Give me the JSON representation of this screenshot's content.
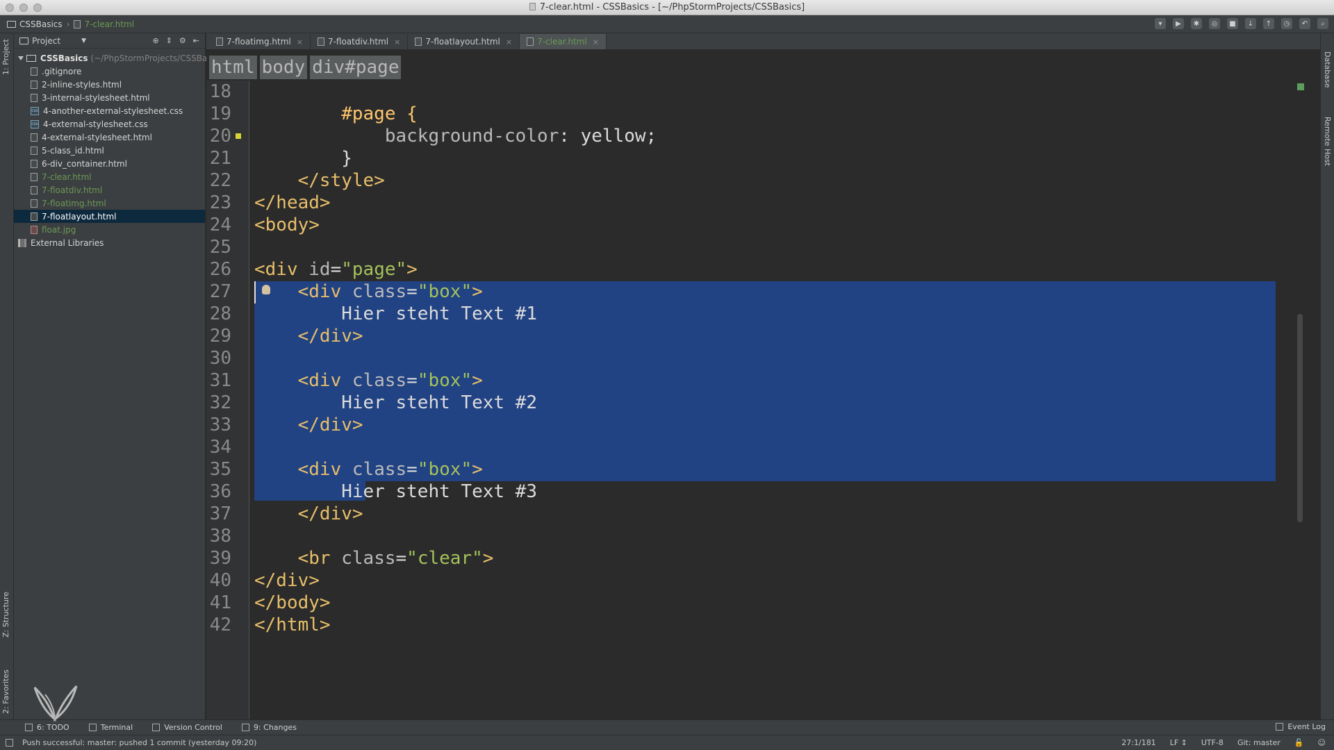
{
  "window": {
    "title": "7-clear.html - CSSBasics - [~/PhpStormProjects/CSSBasics]"
  },
  "navbar": {
    "project": "CSSBasics",
    "file": "7-clear.html"
  },
  "left_strip": {
    "project_tab": "1: Project",
    "structure_tab": "Z: Structure",
    "favorites_tab": "2: Favorites"
  },
  "right_strip": {
    "database_tab": "Database",
    "remote_host_tab": "Remote Host"
  },
  "project_panel": {
    "header": "Project",
    "root": {
      "name": "CSSBasics",
      "path": "(~/PhpStormProjects/CSSBasics)"
    },
    "items": [
      {
        "label": ".gitignore",
        "kind": "file",
        "vcs": "none"
      },
      {
        "label": "2-inline-styles.html",
        "kind": "html",
        "vcs": "none"
      },
      {
        "label": "3-internal-stylesheet.html",
        "kind": "html",
        "vcs": "none"
      },
      {
        "label": "4-another-external-stylesheet.css",
        "kind": "css",
        "vcs": "none"
      },
      {
        "label": "4-external-stylesheet.css",
        "kind": "css",
        "vcs": "none"
      },
      {
        "label": "4-external-stylesheet.html",
        "kind": "html",
        "vcs": "none"
      },
      {
        "label": "5-class_id.html",
        "kind": "html",
        "vcs": "none"
      },
      {
        "label": "6-div_container.html",
        "kind": "html",
        "vcs": "none"
      },
      {
        "label": "7-clear.html",
        "kind": "html",
        "vcs": "new"
      },
      {
        "label": "7-floatdiv.html",
        "kind": "html",
        "vcs": "new"
      },
      {
        "label": "7-floatimg.html",
        "kind": "html",
        "vcs": "new"
      },
      {
        "label": "7-floatlayout.html",
        "kind": "html",
        "vcs": "selected"
      },
      {
        "label": "float.jpg",
        "kind": "image",
        "vcs": "new"
      }
    ],
    "external_libraries": "External Libraries"
  },
  "tabs": [
    {
      "label": "7-floatimg.html",
      "active": false
    },
    {
      "label": "7-floatdiv.html",
      "active": false
    },
    {
      "label": "7-floatlayout.html",
      "active": false
    },
    {
      "label": "7-clear.html",
      "active": true
    }
  ],
  "editor": {
    "breadcrumbs": [
      "html",
      "body",
      "div#page"
    ],
    "lines": [
      {
        "n": "18",
        "tokens": []
      },
      {
        "n": "19",
        "tokens": [
          {
            "t": "        #page {",
            "c": "t-sel-id"
          }
        ]
      },
      {
        "n": "20",
        "tokens": [
          {
            "t": "            background-color",
            "c": "t-prop"
          },
          {
            "t": ": yellow;",
            "c": "t-plain"
          }
        ]
      },
      {
        "n": "21",
        "tokens": [
          {
            "t": "        }",
            "c": "t-plain"
          }
        ]
      },
      {
        "n": "22",
        "tokens": [
          {
            "t": "    </style>",
            "c": "t-sel"
          }
        ]
      },
      {
        "n": "23",
        "tokens": [
          {
            "t": "</head>",
            "c": "t-sel"
          }
        ]
      },
      {
        "n": "24",
        "tokens": [
          {
            "t": "<body>",
            "c": "t-sel"
          }
        ]
      },
      {
        "n": "25",
        "tokens": []
      },
      {
        "n": "26",
        "tokens": [
          {
            "t": "<div ",
            "c": "t-sel"
          },
          {
            "t": "id",
            "c": "t-attr"
          },
          {
            "t": "=",
            "c": "t-plain"
          },
          {
            "t": "\"page\"",
            "c": "t-str"
          },
          {
            "t": ">",
            "c": "t-sel"
          }
        ]
      },
      {
        "n": "27",
        "tokens": [
          {
            "t": "    <div ",
            "c": "t-sel"
          },
          {
            "t": "class",
            "c": "t-attr"
          },
          {
            "t": "=",
            "c": "t-plain"
          },
          {
            "t": "\"box\"",
            "c": "t-str"
          },
          {
            "t": ">",
            "c": "t-sel"
          }
        ]
      },
      {
        "n": "28",
        "tokens": [
          {
            "t": "        Hier steht Text #1",
            "c": "t-plain"
          }
        ]
      },
      {
        "n": "29",
        "tokens": [
          {
            "t": "    </div>",
            "c": "t-sel"
          }
        ]
      },
      {
        "n": "30",
        "tokens": []
      },
      {
        "n": "31",
        "tokens": [
          {
            "t": "    <div ",
            "c": "t-sel"
          },
          {
            "t": "class",
            "c": "t-attr"
          },
          {
            "t": "=",
            "c": "t-plain"
          },
          {
            "t": "\"box\"",
            "c": "t-str"
          },
          {
            "t": ">",
            "c": "t-sel"
          }
        ]
      },
      {
        "n": "32",
        "tokens": [
          {
            "t": "        Hier steht Text #2",
            "c": "t-plain"
          }
        ]
      },
      {
        "n": "33",
        "tokens": [
          {
            "t": "    </div>",
            "c": "t-sel"
          }
        ]
      },
      {
        "n": "34",
        "tokens": []
      },
      {
        "n": "35",
        "tokens": [
          {
            "t": "    <div ",
            "c": "t-sel"
          },
          {
            "t": "class",
            "c": "t-attr"
          },
          {
            "t": "=",
            "c": "t-plain"
          },
          {
            "t": "\"box\"",
            "c": "t-str"
          },
          {
            "t": ">",
            "c": "t-sel"
          }
        ]
      },
      {
        "n": "36",
        "tokens": [
          {
            "t": "        Hier steht Text #3",
            "c": "t-plain"
          }
        ]
      },
      {
        "n": "37",
        "tokens": [
          {
            "t": "    </div>",
            "c": "t-sel"
          }
        ]
      },
      {
        "n": "38",
        "tokens": []
      },
      {
        "n": "39",
        "tokens": [
          {
            "t": "    <br ",
            "c": "t-sel"
          },
          {
            "t": "class",
            "c": "t-attr"
          },
          {
            "t": "=",
            "c": "t-plain"
          },
          {
            "t": "\"clear\"",
            "c": "t-str"
          },
          {
            "t": ">",
            "c": "t-sel"
          }
        ]
      },
      {
        "n": "40",
        "tokens": [
          {
            "t": "</div>",
            "c": "t-sel"
          }
        ]
      },
      {
        "n": "41",
        "tokens": [
          {
            "t": "</body>",
            "c": "t-sel"
          }
        ]
      },
      {
        "n": "42",
        "tokens": [
          {
            "t": "</html>",
            "c": "t-sel"
          }
        ]
      }
    ]
  },
  "bottom_tools": {
    "todo": "6: TODO",
    "terminal": "Terminal",
    "version_control": "Version Control",
    "changes": "9: Changes",
    "event_log": "Event Log"
  },
  "status": {
    "message": "Push successful: master: pushed 1 commit (yesterday 09:20)",
    "position": "27:1/181",
    "line_sep": "LF ↕",
    "encoding": "UTF-8",
    "git": "Git: master"
  },
  "colors": {
    "selection": "#214283",
    "tag": "#e8bf6a",
    "string": "#a5c25c",
    "vcs_new": "#6a9955"
  }
}
